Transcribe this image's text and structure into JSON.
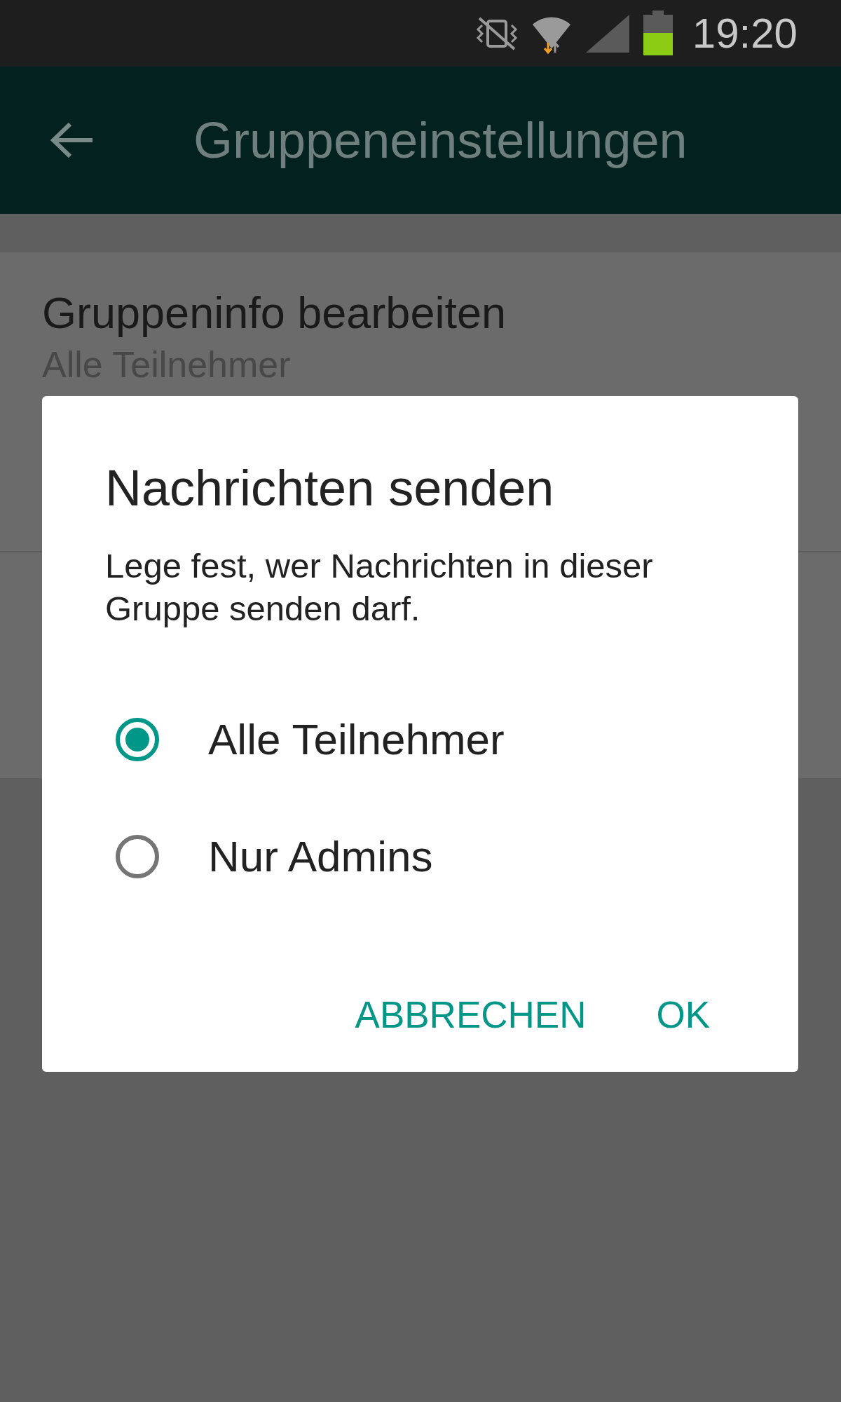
{
  "status_bar": {
    "time": "19:20"
  },
  "app_bar": {
    "title": "Gruppeneinstellungen"
  },
  "settings": [
    {
      "title": "Gruppeninfo bearbeiten",
      "subtitle": "Alle Teilnehmer"
    }
  ],
  "dialog": {
    "title": "Nachrichten senden",
    "message": "Lege fest, wer Nachrichten in dieser Gruppe senden darf.",
    "options": [
      {
        "label": "Alle Teilnehmer",
        "selected": true
      },
      {
        "label": "Nur Admins",
        "selected": false
      }
    ],
    "buttons": [
      "ABBRECHEN",
      "OK"
    ]
  }
}
